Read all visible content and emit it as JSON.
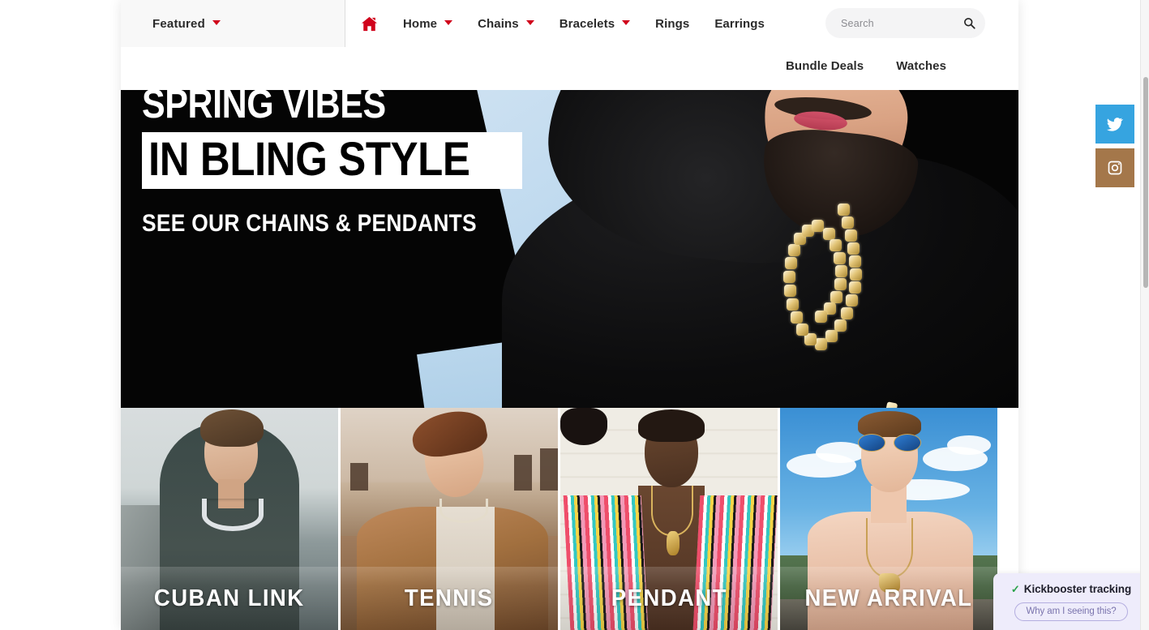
{
  "header": {
    "featured": {
      "label": "Featured",
      "caret_icon": "chevron-down-icon"
    },
    "home_icon": "home-icon",
    "nav_primary": [
      {
        "label": "Home",
        "has_dropdown": true
      },
      {
        "label": "Chains",
        "has_dropdown": true
      },
      {
        "label": "Bracelets",
        "has_dropdown": true
      },
      {
        "label": "Rings",
        "has_dropdown": false
      },
      {
        "label": "Earrings",
        "has_dropdown": false
      }
    ],
    "nav_secondary": [
      {
        "label": "Bundle Deals"
      },
      {
        "label": "Watches"
      }
    ],
    "search": {
      "placeholder": "Search",
      "value": "",
      "icon": "search-icon"
    }
  },
  "hero": {
    "line1": "SPRING VIBES",
    "line2": "IN BLING STYLE",
    "line3": "SEE OUR CHAINS & PENDANTS",
    "alt": "bearded man in black hoodie wearing iced out gold cuban link chain with cross pendant"
  },
  "tiles": [
    {
      "label": "CUBAN LINK",
      "alt": "young man by railroad wearing silver cuban link chain"
    },
    {
      "label": "TENNIS",
      "alt": "man in corduroy jacket on rooftop wearing tennis chain"
    },
    {
      "label": "PENDANT",
      "alt": "man in striped shirt wearing gold pendant"
    },
    {
      "label": "NEW ARRIVAL",
      "alt": "man with mirrored sunglasses wearing gold pendant outdoors"
    }
  ],
  "social": [
    {
      "name": "twitter",
      "icon": "twitter-icon",
      "color": "#36a4e0"
    },
    {
      "name": "instagram",
      "icon": "instagram-icon",
      "color": "#a4774a"
    }
  ],
  "kickbooster": {
    "check_icon": "check-icon",
    "title": "Kickbooster tracking",
    "button_label": "Why am I seeing this?",
    "accent": "#7a74ad",
    "background": "#eeecfb",
    "check_color": "#2aa34a"
  },
  "theme": {
    "accent_red": "#d0021b",
    "text_dark": "#2b2b2b",
    "panel_grey": "#f8f8f8",
    "search_grey": "#f4f4f5"
  },
  "scrollbar": {
    "orientation": "vertical",
    "thumb_color": "#b6b6b6"
  }
}
